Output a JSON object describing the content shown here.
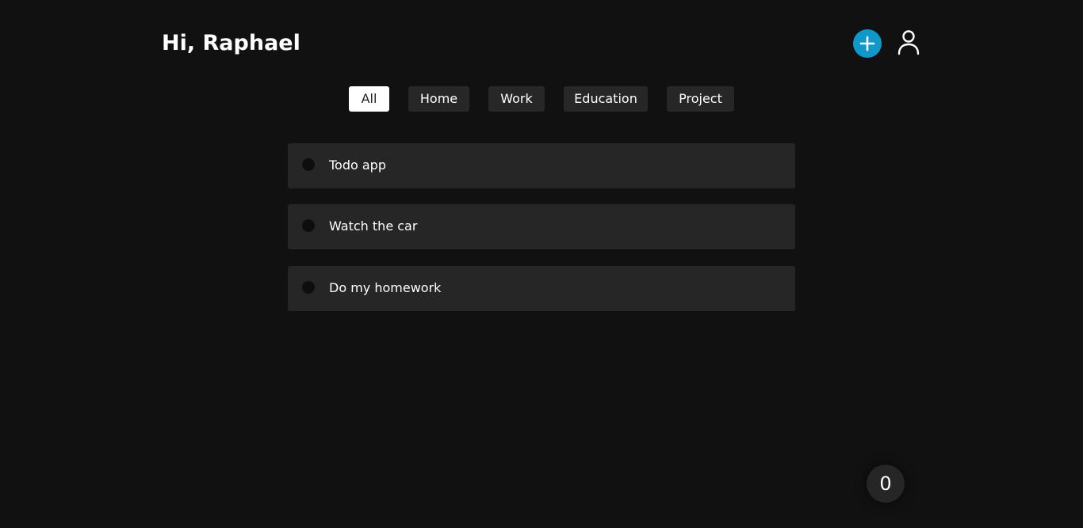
{
  "header": {
    "greeting": "Hi, Raphael",
    "add_icon": "plus-icon",
    "profile_icon": "user-icon"
  },
  "filters": [
    {
      "label": "All",
      "active": true
    },
    {
      "label": "Home",
      "active": false
    },
    {
      "label": "Work",
      "active": false
    },
    {
      "label": "Education",
      "active": false
    },
    {
      "label": "Project",
      "active": false
    }
  ],
  "tasks": [
    {
      "text": "Todo app"
    },
    {
      "text": "Watch the car"
    },
    {
      "text": "Do my homework"
    }
  ],
  "counter": {
    "value": "0"
  },
  "colors": {
    "background": "#111111",
    "card": "#262626",
    "accent": "#0f98c8",
    "active_filter": "#ffffff"
  }
}
